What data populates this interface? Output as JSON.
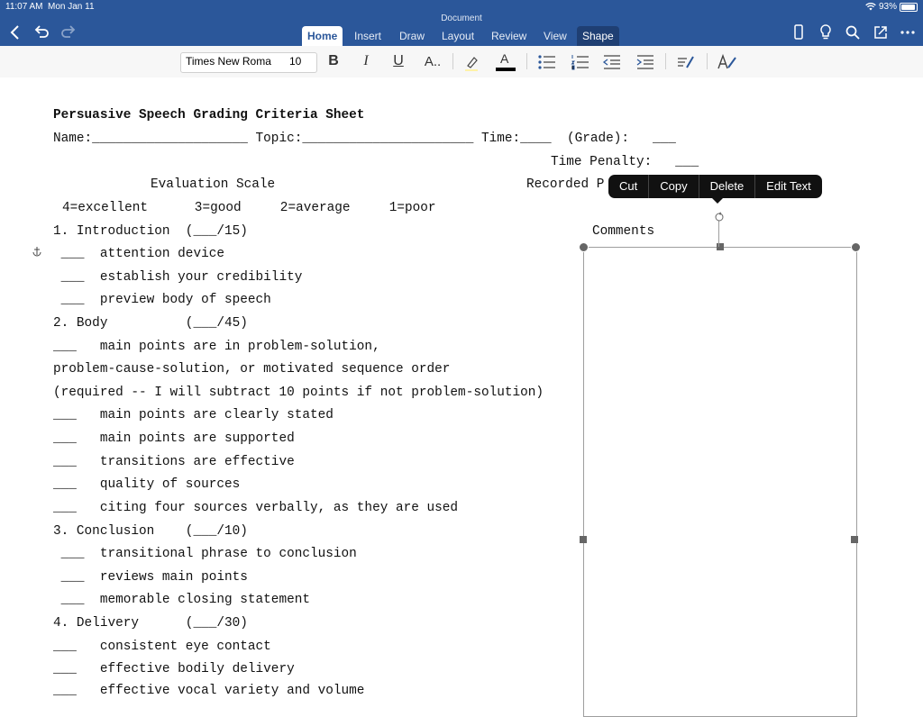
{
  "status": {
    "time": "11:07 AM",
    "date": "Mon Jan 11",
    "battery": "93%"
  },
  "app": {
    "doc_title": "Document"
  },
  "tabs": [
    {
      "label": "Home"
    },
    {
      "label": "Insert"
    },
    {
      "label": "Draw"
    },
    {
      "label": "Layout"
    },
    {
      "label": "Review"
    },
    {
      "label": "View"
    },
    {
      "label": "Shape"
    }
  ],
  "ribbon": {
    "font_name": "Times New Roman",
    "font_size": "10",
    "bold": "B",
    "italic": "I",
    "underline": "U",
    "text_effects": "A..",
    "font_color": "A"
  },
  "context_menu": {
    "cut": "Cut",
    "copy": "Copy",
    "delete": "Delete",
    "edit_text": "Edit Text"
  },
  "document": {
    "title": "Persuasive Speech Grading Criteria Sheet",
    "name_line": "Name:____________________ Topic:______________________ Time:____  (Grade):   ___",
    "time_penalty": "Time Penalty:   ___",
    "eval_scale": "Evaluation Scale",
    "recorded": "Recorded P",
    "scale_line": "4=excellent      3=good     2=average     1=poor",
    "comments": "Comments",
    "intro": "1. Introduction  (___/15)",
    "intro_1": " ___  attention device",
    "intro_2": " ___  establish your credibility",
    "intro_3": " ___  preview body of speech",
    "body": "2. Body          (___/45)",
    "body_1a": "___   main points are in problem-solution,",
    "body_1b": "problem-cause-solution, or motivated sequence order",
    "body_1c": "(required -- I will subtract 10 points if not problem-solution)",
    "body_2": "___   main points are clearly stated",
    "body_3": "___   main points are supported",
    "body_4": "___   transitions are effective",
    "body_5": "___   quality of sources",
    "body_6": "___   citing four sources verbally, as they are used",
    "conclusion": "3. Conclusion    (___/10)",
    "concl_1": " ___  transitional phrase to conclusion",
    "concl_2": " ___  reviews main points",
    "concl_3": " ___  memorable closing statement",
    "delivery": "4. Delivery      (___/30)",
    "deliv_1": "___   consistent eye contact",
    "deliv_2": "___   effective bodily delivery",
    "deliv_3": "___   effective vocal variety and volume"
  }
}
